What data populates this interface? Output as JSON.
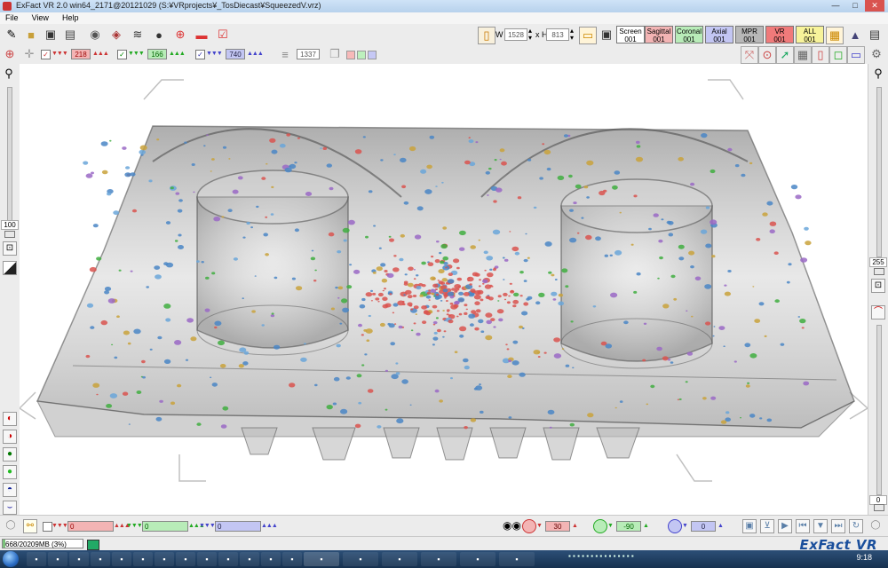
{
  "window": {
    "title": "ExFact VR 2.0 win64_2171@20121029 (S:¥VRprojects¥_TosDiecast¥SqueezedV.vrz)",
    "minimize": "—",
    "maximize": "□",
    "close": "✕"
  },
  "menu": {
    "items": [
      "File",
      "View",
      "Help"
    ]
  },
  "toolbar": {
    "w_label": "W",
    "w_value": "1528",
    "h_label": "x H",
    "h_value": "813",
    "views": [
      {
        "label": "Screen",
        "count": "001",
        "color": "#ffffff"
      },
      {
        "label": "Sagittal",
        "count": "001",
        "color": "#f3b4b4"
      },
      {
        "label": "Coronal",
        "count": "001",
        "color": "#b8ecb8"
      },
      {
        "label": "Axial",
        "count": "001",
        "color": "#c3c6f3"
      },
      {
        "label": "MPR",
        "count": "001",
        "color": "#b8b8b8"
      },
      {
        "label": "VR",
        "count": "001",
        "color": "#f07a7a"
      },
      {
        "label": "ALL",
        "count": "001",
        "color": "#f7f39a"
      }
    ]
  },
  "toolbar2": {
    "sagittal_value": "218",
    "coronal_value": "166",
    "axial_value": "740",
    "slice_value": "1337"
  },
  "left_panel": {
    "slider_value": "100"
  },
  "right_panel": {
    "slider_value": "255",
    "lower_value": "0"
  },
  "bottom_bar": {
    "sagittal_value": "0",
    "coronal_value": "0",
    "axial_value": "0",
    "rot_x": "30",
    "rot_y": "-90",
    "rot_z": "0"
  },
  "status": {
    "memory": "668/20209MB (3%)",
    "memory_fraction": 0.03,
    "brand": "ExFact VR"
  },
  "taskbar": {
    "clock": "9:18"
  },
  "colors": {
    "sagittal": "#f3b4b4",
    "coronal": "#b8ecb8",
    "axial": "#c3c6f3",
    "brand": "#1a4f9c"
  }
}
